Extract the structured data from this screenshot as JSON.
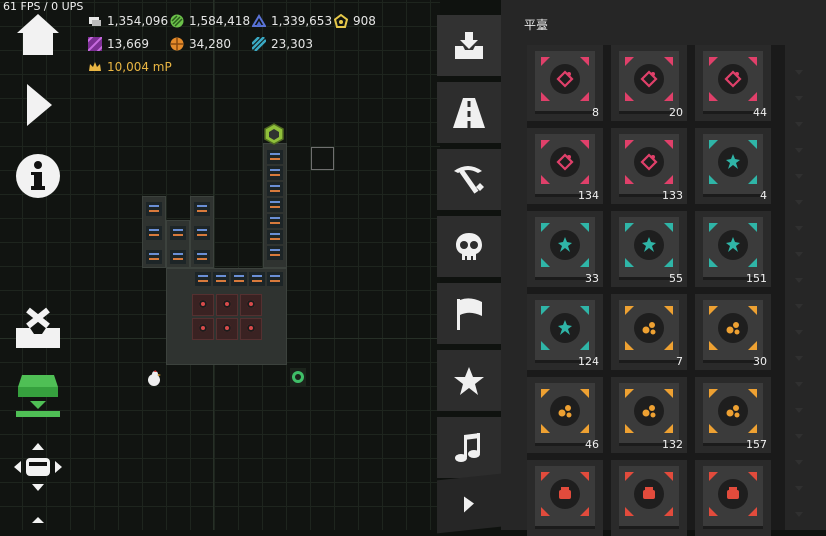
{
  "hud": {
    "fps": "61 FPS / 0 UPS",
    "resources": [
      {
        "icon": "coins-icon",
        "value": "1,354,096"
      },
      {
        "icon": "green-scales-icon",
        "value": "1,584,418"
      },
      {
        "icon": "blue-crystal-icon",
        "value": "1,339,653"
      },
      {
        "icon": "yellow-pentagon-icon",
        "value": "908"
      },
      {
        "icon": "purple-stripes-icon",
        "value": "13,669"
      },
      {
        "icon": "orange-orb-icon",
        "value": "34,280"
      },
      {
        "icon": "teal-stripes-icon",
        "value": "23,303"
      }
    ],
    "power": {
      "icon": "crown-icon",
      "value": "10,004 mP"
    }
  },
  "toolbar": [
    "home-icon",
    "play-icon",
    "info-icon",
    "cancel-build-icon",
    "build-menu-icon",
    "move-camera-icon"
  ],
  "tabs": [
    {
      "name": "tab-build",
      "icon": "download-tray-icon",
      "active": true
    },
    {
      "name": "tab-roads",
      "icon": "road-icon"
    },
    {
      "name": "tab-mining",
      "icon": "pickaxe-icon"
    },
    {
      "name": "tab-enemies",
      "icon": "skull-icon"
    },
    {
      "name": "tab-flags",
      "icon": "flag-icon"
    },
    {
      "name": "tab-favorites",
      "icon": "star-icon"
    },
    {
      "name": "tab-music",
      "icon": "music-note-icon"
    }
  ],
  "panel": {
    "title": "平臺",
    "items": [
      {
        "color": "#e0406a",
        "icon": "pink-gem-icon",
        "count": "8"
      },
      {
        "color": "#e0406a",
        "icon": "pink-gem-icon",
        "count": "20"
      },
      {
        "color": "#e0406a",
        "icon": "pink-gem-icon",
        "count": "44"
      },
      {
        "color": "#e0406a",
        "icon": "pink-gem-icon",
        "count": "134"
      },
      {
        "color": "#e0406a",
        "icon": "pink-gem-icon",
        "count": "133"
      },
      {
        "color": "#2fb5a7",
        "icon": "teal-crystal-icon",
        "count": "4"
      },
      {
        "color": "#2fb5a7",
        "icon": "teal-crystal-icon",
        "count": "33"
      },
      {
        "color": "#2fb5a7",
        "icon": "teal-crystal-icon",
        "count": "55"
      },
      {
        "color": "#2fb5a7",
        "icon": "teal-crystal-icon",
        "count": "151"
      },
      {
        "color": "#2fb5a7",
        "icon": "teal-crystal-icon",
        "count": "124"
      },
      {
        "color": "#eea132",
        "icon": "orange-ore-icon",
        "count": "7"
      },
      {
        "color": "#eea132",
        "icon": "orange-ore-icon",
        "count": "30"
      },
      {
        "color": "#eea132",
        "icon": "orange-ore-icon",
        "count": "46"
      },
      {
        "color": "#eea132",
        "icon": "orange-ore-icon",
        "count": "132"
      },
      {
        "color": "#eea132",
        "icon": "orange-ore-icon",
        "count": "157"
      },
      {
        "color": "#e24b3c",
        "icon": "red-fist-icon",
        "count": ""
      },
      {
        "color": "#e24b3c",
        "icon": "red-fist-icon",
        "count": ""
      },
      {
        "color": "#e24b3c",
        "icon": "red-fist-icon",
        "count": ""
      }
    ]
  }
}
